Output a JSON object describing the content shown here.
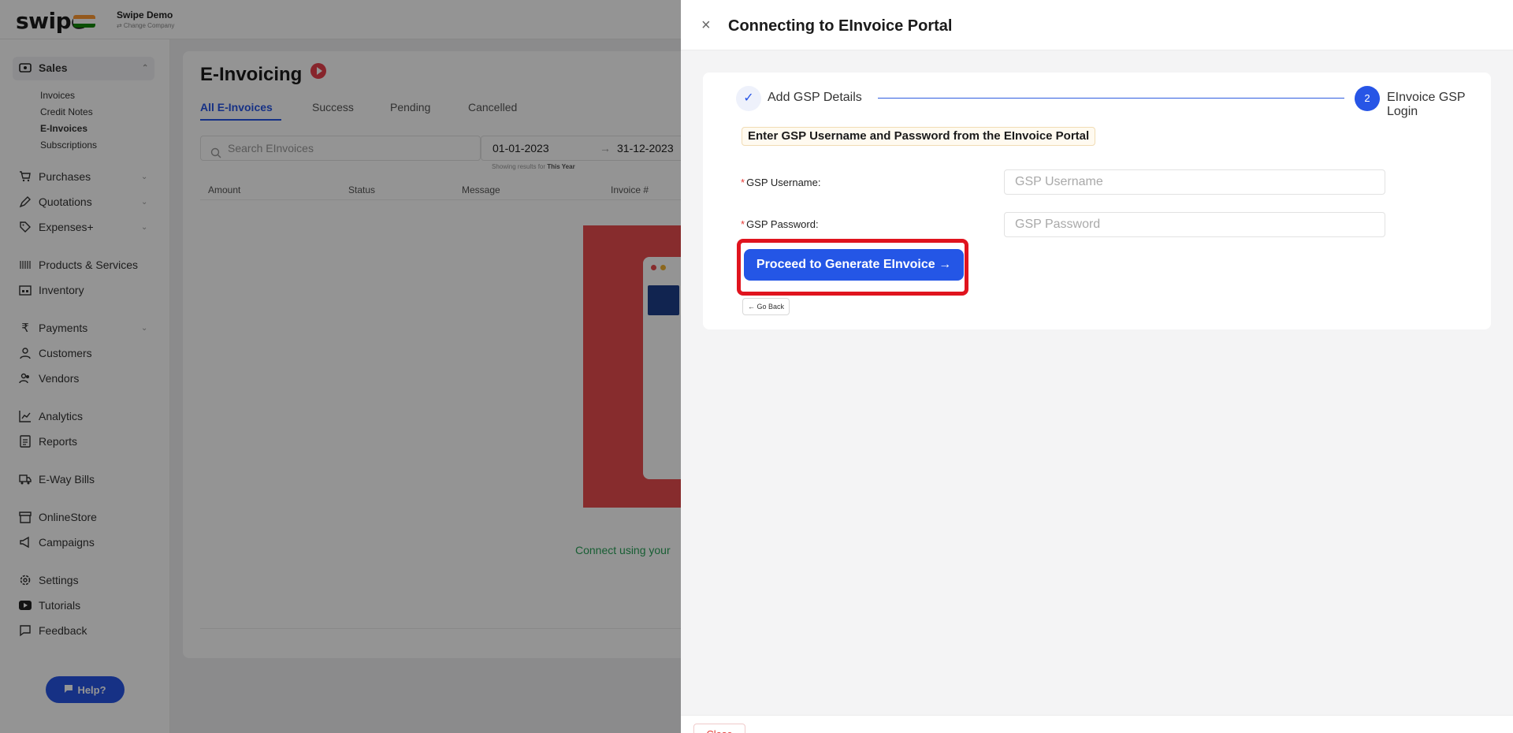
{
  "app": {
    "logo_text": "swipe",
    "company_name": "Swipe Demo",
    "change_company": "⇄ Change Company",
    "flag_colors": [
      "#ff9933",
      "#ffffff",
      "#138808"
    ]
  },
  "sidebar": {
    "sales": {
      "label": "Sales",
      "icon": "sales-icon"
    },
    "sales_sub": [
      "Invoices",
      "Credit Notes",
      "E-Invoices",
      "Subscriptions"
    ],
    "items": [
      {
        "label": "Purchases",
        "icon": "cart-icon",
        "caret": "⌄"
      },
      {
        "label": "Quotations",
        "icon": "pen-icon",
        "caret": "⌄"
      },
      {
        "label": "Expenses+",
        "icon": "tag-icon",
        "caret": "⌄"
      },
      {
        "label": "Products & Services",
        "icon": "barcode-icon"
      },
      {
        "label": "Inventory",
        "icon": "warehouse-icon"
      },
      {
        "label": "Payments",
        "icon": "rupee-icon",
        "caret": "⌄"
      },
      {
        "label": "Customers",
        "icon": "user-icon"
      },
      {
        "label": "Vendors",
        "icon": "users-icon"
      },
      {
        "label": "Analytics",
        "icon": "chart-icon"
      },
      {
        "label": "Reports",
        "icon": "report-icon"
      },
      {
        "label": "E-Way Bills",
        "icon": "truck-icon"
      },
      {
        "label": "OnlineStore",
        "icon": "store-icon"
      },
      {
        "label": "Campaigns",
        "icon": "megaphone-icon"
      },
      {
        "label": "Settings",
        "icon": "gear-icon"
      },
      {
        "label": "Tutorials",
        "icon": "youtube-icon"
      },
      {
        "label": "Feedback",
        "icon": "chat-icon"
      }
    ],
    "help_label": "Help?"
  },
  "main": {
    "title": "E-Invoicing",
    "tabs": [
      "All E-Invoices",
      "Success",
      "Pending",
      "Cancelled"
    ],
    "search_placeholder": "Search EInvoices",
    "date_from": "01-01-2023",
    "date_arrow": "→",
    "date_to": "31-12-2023",
    "showing_prefix": "Showing results for",
    "showing_period": "This Year",
    "columns": [
      "Amount",
      "Status",
      "Message",
      "Invoice #"
    ],
    "connect_text": "Connect using your"
  },
  "drawer": {
    "close_symbol": "×",
    "title": "Connecting to EInvoice Portal",
    "steps": [
      {
        "marker": "✓",
        "label": "Add GSP Details"
      },
      {
        "marker": "2",
        "label": "EInvoice GSP Login"
      }
    ],
    "instruction": "Enter GSP Username and Password from the EInvoice Portal",
    "fields": [
      {
        "required_mark": "*",
        "label": "GSP Username:",
        "placeholder": "GSP Username",
        "value": ""
      },
      {
        "required_mark": "*",
        "label": "GSP Password:",
        "placeholder": "GSP Password",
        "value": ""
      }
    ],
    "proceed_label": "Proceed to Generate EInvoice →",
    "go_back_label": "← Go Back",
    "footer_close_label": "Close",
    "accent_color": "#2456e6",
    "highlight_color": "#e0141e"
  }
}
